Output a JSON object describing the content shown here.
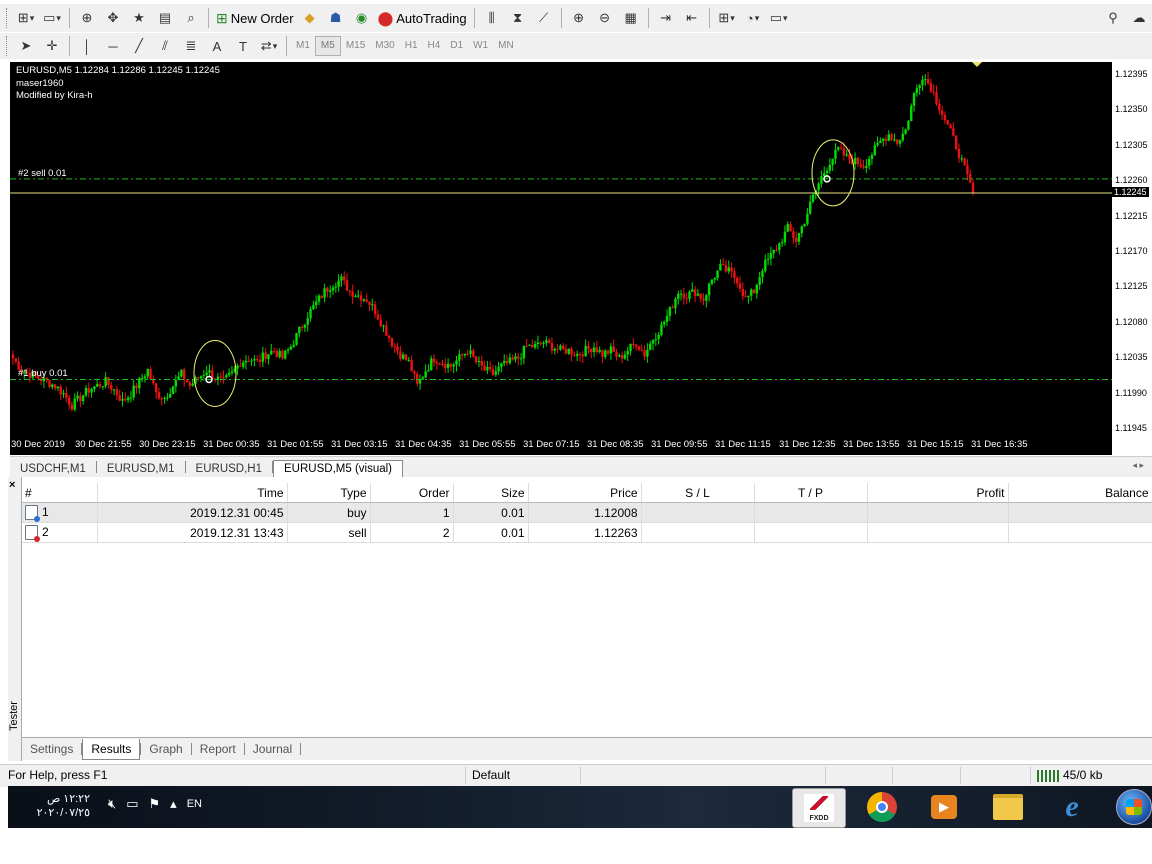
{
  "toolbar": {
    "new_order_label": "New Order",
    "autotrading_label": "AutoTrading",
    "periods": [
      "M1",
      "M5",
      "M15",
      "M30",
      "H1",
      "H4",
      "D1",
      "W1",
      "MN"
    ],
    "active_period": "M5"
  },
  "chart": {
    "info_line": "EURUSD,M5  1.12284 1.12286 1.12245 1.12245",
    "indicator_line1": "maser1960",
    "indicator_line2": "Modified by Kira-h",
    "sell_label": "#2 sell 0.01",
    "buy_label": "#1 buy 0.01",
    "current_price": "1.12245",
    "y_ticks": [
      "1.12395",
      "1.12350",
      "1.12305",
      "1.12260",
      "1.12215",
      "1.12170",
      "1.12125",
      "1.12080",
      "1.12035",
      "1.11990",
      "1.11945"
    ],
    "x_ticks": [
      "30 Dec 2019",
      "30 Dec 21:55",
      "30 Dec 23:15",
      "31 Dec 00:35",
      "31 Dec 01:55",
      "31 Dec 03:15",
      "31 Dec 04:35",
      "31 Dec 05:55",
      "31 Dec 07:15",
      "31 Dec 08:35",
      "31 Dec 09:55",
      "31 Dec 11:15",
      "31 Dec 12:35",
      "31 Dec 13:55",
      "31 Dec 15:15",
      "31 Dec 16:35"
    ],
    "colors": {
      "background": "#000000",
      "bull": "#00dd00",
      "bear": "#ee1111",
      "order_line": "#22bb22",
      "price_line": "#e8e080",
      "circle": "#f0f070"
    }
  },
  "chart_data": {
    "type": "candlestick",
    "symbol": "EURUSD",
    "timeframe": "M5",
    "ylim": [
      1.11935,
      1.1241
    ],
    "close_path": [
      1.12035,
      1.1202,
      1.12015,
      1.1201,
      1.12005,
      1.12,
      1.1199,
      1.11975,
      1.11985,
      1.11995,
      1.12,
      1.12005,
      1.11995,
      1.1198,
      1.1199,
      1.12005,
      1.1202,
      1.1199,
      1.11985,
      1.12,
      1.12015,
      1.12,
      1.1201,
      1.1202,
      1.1201,
      1.12005,
      1.12015,
      1.1203,
      1.12035,
      1.1203,
      1.1204,
      1.12045,
      1.12035,
      1.1205,
      1.1207,
      1.1209,
      1.12105,
      1.1212,
      1.1213,
      1.12135,
      1.1212,
      1.12115,
      1.1211,
      1.12095,
      1.12075,
      1.12055,
      1.1204,
      1.1203,
      1.12,
      1.1202,
      1.12035,
      1.1203,
      1.12025,
      1.12035,
      1.12045,
      1.1203,
      1.1202,
      1.12015,
      1.12025,
      1.1203,
      1.12035,
      1.1205,
      1.1205,
      1.12055,
      1.1205,
      1.12045,
      1.12045,
      1.1204,
      1.12045,
      1.1205,
      1.1204,
      1.12045,
      1.12035,
      1.12045,
      1.12055,
      1.1204,
      1.1206,
      1.12075,
      1.12095,
      1.1212,
      1.12115,
      1.1212,
      1.1211,
      1.12135,
      1.1215,
      1.12145,
      1.12135,
      1.1211,
      1.1212,
      1.1215,
      1.12165,
      1.1218,
      1.122,
      1.12185,
      1.1221,
      1.1224,
      1.12265,
      1.12285,
      1.123,
      1.1229,
      1.12285,
      1.1228,
      1.12295,
      1.1231,
      1.1232,
      1.1231,
      1.12325,
      1.1237,
      1.12395,
      1.1238,
      1.12355,
      1.1233,
      1.12305,
      1.12275,
      1.12245
    ],
    "orders": [
      {
        "id": 1,
        "type": "buy",
        "size": 0.01,
        "price": 1.12008
      },
      {
        "id": 2,
        "type": "sell",
        "size": 0.01,
        "price": 1.12263
      }
    ],
    "x_ticks": [
      "30 Dec 2019",
      "30 Dec 21:55",
      "30 Dec 23:15",
      "31 Dec 00:35",
      "31 Dec 01:55",
      "31 Dec 03:15",
      "31 Dec 04:35",
      "31 Dec 05:55",
      "31 Dec 07:15",
      "31 Dec 08:35",
      "31 Dec 09:55",
      "31 Dec 11:15",
      "31 Dec 12:35",
      "31 Dec 13:55",
      "31 Dec 15:15",
      "31 Dec 16:35"
    ],
    "y_ticks": [
      1.12395,
      1.1235,
      1.12305,
      1.1226,
      1.12215,
      1.1217,
      1.12125,
      1.1208,
      1.12035,
      1.1199,
      1.11945
    ],
    "last_price": 1.12245
  },
  "chart_tabs": [
    "USDCHF,M1",
    "EURUSD,M1",
    "EURUSD,H1",
    "EURUSD,M5 (visual)"
  ],
  "tester": {
    "side_label": "Tester",
    "columns": [
      "#",
      "Time",
      "Type",
      "Order",
      "Size",
      "Price",
      "S / L",
      "T / P",
      "Profit",
      "Balance"
    ],
    "rows": [
      {
        "num": "1",
        "time": "2019.12.31 00:45",
        "type": "buy",
        "order": "1",
        "size": "0.01",
        "price": "1.12008",
        "sl": "",
        "tp": "",
        "profit": "",
        "balance": ""
      },
      {
        "num": "2",
        "time": "2019.12.31 13:43",
        "type": "sell",
        "order": "2",
        "size": "0.01",
        "price": "1.12263",
        "sl": "",
        "tp": "",
        "profit": "",
        "balance": ""
      }
    ],
    "tabs": [
      "Settings",
      "Results",
      "Graph",
      "Report",
      "Journal"
    ]
  },
  "status": {
    "help": "For Help, press F1",
    "profile": "Default",
    "traffic": "45/0 kb"
  },
  "taskbar": {
    "time": "١٢:٢٢ ص",
    "date": "٢٠٢٠/٠٧/٢٥",
    "lang": "EN",
    "fxdd_label": "FXDD"
  }
}
